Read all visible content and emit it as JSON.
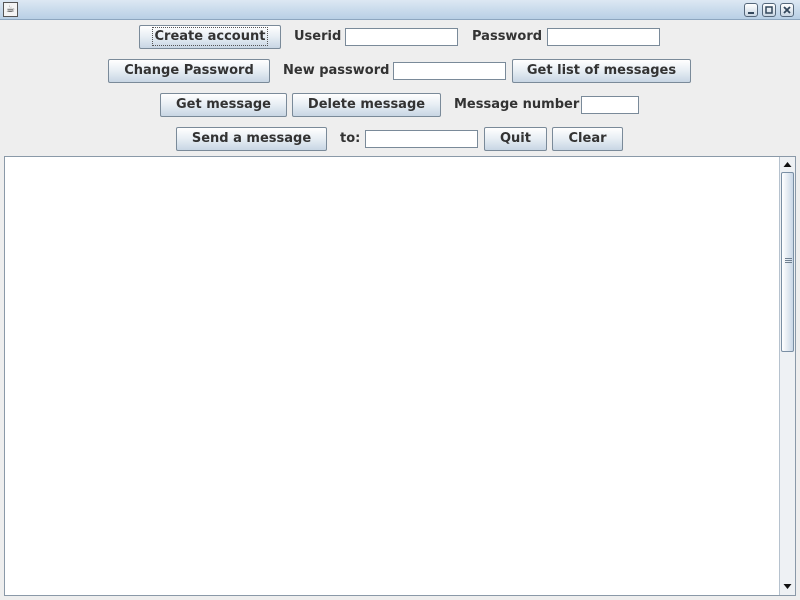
{
  "window": {
    "title": ""
  },
  "row1": {
    "create_account": "Create account",
    "userid_label": "Userid",
    "userid_value": "",
    "password_label": "Password",
    "password_value": ""
  },
  "row2": {
    "change_password": "Change Password",
    "new_password_label": "New password",
    "new_password_value": "",
    "get_list": "Get list of messages"
  },
  "row3": {
    "get_message": "Get message",
    "delete_message": "Delete message",
    "message_number_label": "Message number",
    "message_number_value": ""
  },
  "row4": {
    "send_message": "Send a message",
    "to_label": "to:",
    "to_value": "",
    "quit": "Quit",
    "clear": "Clear"
  },
  "output": {
    "text": ""
  },
  "icons": {
    "app": "java-app-icon",
    "minimize": "minimize-icon",
    "maximize": "maximize-icon",
    "close": "close-icon",
    "scroll_up": "scroll-up-arrow-icon",
    "scroll_down": "scroll-down-arrow-icon"
  },
  "colors": {
    "titlebar": "#b8cfe5",
    "background": "#eeeeee",
    "button_top": "#ffffff",
    "button_bottom": "#c8d6e4"
  }
}
